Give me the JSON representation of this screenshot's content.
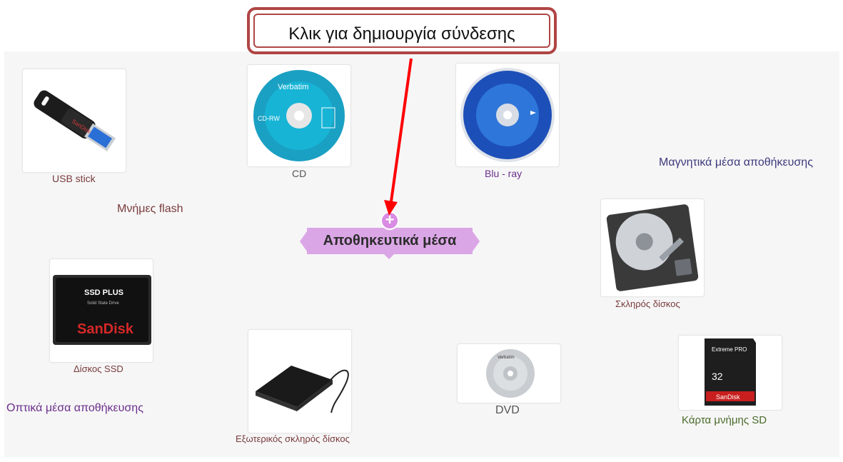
{
  "callout": {
    "text": "Κλικ για δημιουργία σύνδεσης"
  },
  "central_topic": {
    "label": "Αποθηκευτικά μέσα",
    "add_icon": "plus-icon"
  },
  "categories": {
    "flash": "Μνήμες flash",
    "magnetic": "Μαγνητικά μέσα αποθήκευσης",
    "optical": "Οπτικά μέσα αποθήκευσης"
  },
  "items": {
    "usb": "USB stick",
    "cd": "CD",
    "bluray": "Blu - ray",
    "hdd": "Σκληρός δίσκος",
    "ssd": "Δίσκος SSD",
    "external": "Εξωτερικός σκληρός δίσκος",
    "dvd": "DVD",
    "sdcard": "Κάρτα μνήμης SD"
  },
  "image_text": {
    "cd_brand": "Verbatim",
    "cd_type": "CD-RW",
    "ssd_line1": "SSD PLUS",
    "ssd_line2": "Solid State Drive",
    "ssd_brand": "SanDisk",
    "usb_brand": "SanDisk",
    "dvd_brand": "Verbatim",
    "sd_line1": "Extreme PRO",
    "sd_capacity": "32",
    "sd_brand": "SanDisk"
  },
  "colors": {
    "callout_border": "#b04545",
    "central_fill": "#dba6e6",
    "arrow": "#ff0000"
  }
}
